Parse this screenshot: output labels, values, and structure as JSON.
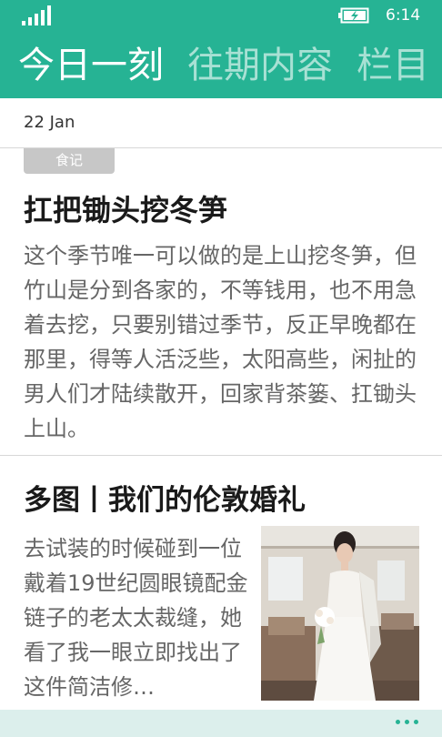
{
  "status": {
    "time": "6:14"
  },
  "pivot": {
    "tabs": [
      "今日一刻",
      "往期内容",
      "栏目"
    ]
  },
  "date": "22 Jan",
  "article1": {
    "tag": "食记",
    "title": "扛把锄头挖冬笋",
    "body": "这个季节唯一可以做的是上山挖冬笋，但竹山是分到各家的，不等钱用，也不用急着去挖，只要别错过季节，反正早晚都在那里，得等人活泛些，太阳高些，闲扯的男人们才陆续散开，回家背茶篓、扛锄头上山。"
  },
  "article2": {
    "title": "多图丨我们的伦敦婚礼",
    "body": "去试装的时候碰到一位戴着19世纪圆眼镜配金链子的老太太裁缝，她看了我一眼立即找出了这件简洁修…"
  },
  "colors": {
    "accent": "#26b394",
    "appbar": "#dcefec"
  },
  "icons": [
    "signal-icon",
    "battery-charging-icon",
    "more-dots-icon"
  ]
}
